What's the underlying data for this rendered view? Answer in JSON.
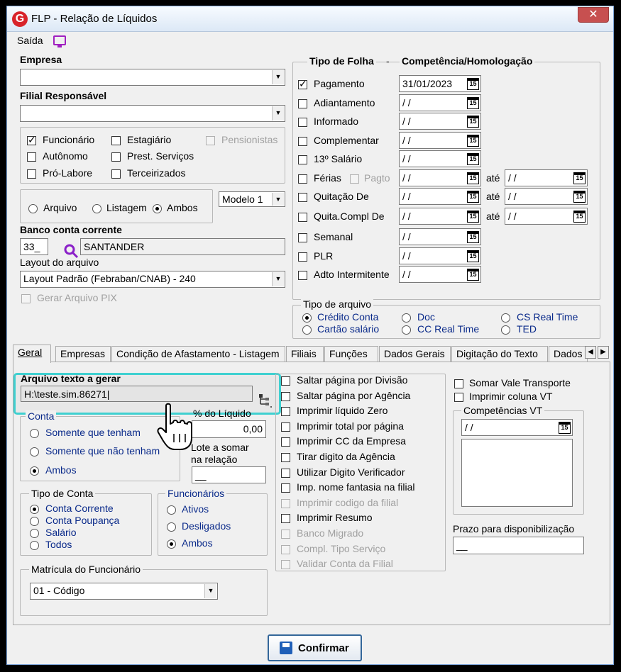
{
  "window": {
    "title": "FLP - Relação de Líquidos",
    "logo": "G",
    "close": "✕"
  },
  "menu": {
    "saida": "Saída"
  },
  "empresa": {
    "label": "Empresa",
    "value": ""
  },
  "filial": {
    "label": "Filial Responsável",
    "value": ""
  },
  "categorias": [
    {
      "label": "Funcionário",
      "checked": true,
      "enabled": true
    },
    {
      "label": "Estagiário",
      "checked": false,
      "enabled": true
    },
    {
      "label": "Pensionistas",
      "checked": false,
      "enabled": false
    },
    {
      "label": "Autônomo",
      "checked": false,
      "enabled": true
    },
    {
      "label": "Prest. Serviços",
      "checked": false,
      "enabled": true
    },
    {
      "label": "Pró-Labore",
      "checked": false,
      "enabled": true
    },
    {
      "label": "Terceirizados",
      "checked": false,
      "enabled": true
    }
  ],
  "saida_tipo": {
    "options": [
      "Arquivo",
      "Listagem",
      "Ambos"
    ],
    "selected": "Ambos"
  },
  "modelo": {
    "value": "Modelo 1"
  },
  "banco": {
    "label": "Banco conta corrente",
    "code": "33_",
    "name": "SANTANDER"
  },
  "layout": {
    "label": "Layout do arquivo",
    "value": "Layout Padrão (Febraban/CNAB) - 240"
  },
  "pix": {
    "label": "Gerar Arquivo PIX"
  },
  "folha": {
    "title_tipo": "Tipo de Folha",
    "title_comp": "Competência/Homologação",
    "ate": "até",
    "pagto": "Pagto",
    "items": [
      {
        "label": "Pagamento",
        "checked": true,
        "date": "31/01/2023",
        "end": ""
      },
      {
        "label": "Adiantamento",
        "checked": false,
        "date": "/ /",
        "end": ""
      },
      {
        "label": "Informado",
        "checked": false,
        "date": "/ /",
        "end": ""
      },
      {
        "label": "Complementar",
        "checked": false,
        "date": "/ /",
        "end": ""
      },
      {
        "label": "13º Salário",
        "checked": false,
        "date": "/ /",
        "end": ""
      },
      {
        "label": "Férias",
        "checked": false,
        "date": "/ /",
        "end": "/ /"
      },
      {
        "label": "Quitação De",
        "checked": false,
        "date": "/ /",
        "end": "/ /"
      },
      {
        "label": "Quita.Compl De",
        "checked": false,
        "date": "/ /",
        "end": "/ /"
      },
      {
        "label": "Semanal",
        "checked": false,
        "date": "/ /",
        "end": ""
      },
      {
        "label": "PLR",
        "checked": false,
        "date": "/ /",
        "end": ""
      },
      {
        "label": "Adto Intermitente",
        "checked": false,
        "date": "/ /",
        "end": ""
      }
    ]
  },
  "tipo_arquivo": {
    "title": "Tipo de arquivo",
    "options": [
      "Crédito Conta",
      "Doc",
      "CS Real Time",
      "Cartão salário",
      "CC Real Time",
      "TED"
    ],
    "selected": "Crédito Conta"
  },
  "tabs": [
    "Geral",
    "Empresas",
    "Condição de Afastamento - Listagem",
    "Filiais",
    "Funções",
    "Dados Gerais",
    "Digitação do Texto",
    "Dados"
  ],
  "geral": {
    "arquivo_label": "Arquivo texto a gerar",
    "arquivo_value": "H:\\teste.sim.86271|",
    "conta": {
      "title": "Conta",
      "options": [
        "Somente que tenham",
        "Somente que não tenham",
        "Ambos"
      ],
      "selected": "Ambos"
    },
    "perc_label": "% do Líquido",
    "perc_value": "0,00",
    "lote_label_1": "Lote a somar",
    "lote_label_2": "na relação",
    "lote_value": "__",
    "tipo_conta": {
      "title": "Tipo de Conta",
      "options": [
        "Conta Corrente",
        "Conta Poupança",
        "Salário",
        "Todos"
      ],
      "selected": "Conta Corrente"
    },
    "funcionarios": {
      "title": "Funcionários",
      "options": [
        "Ativos",
        "Desligados",
        "Ambos"
      ],
      "selected": "Ambos"
    },
    "matricula": {
      "title": "Matrícula do Funcionário",
      "value": "01 - Código"
    },
    "opcoes": [
      {
        "label": "Saltar página por Divisão",
        "enabled": true
      },
      {
        "label": "Saltar página por Agência",
        "enabled": true
      },
      {
        "label": "Imprimir líquido Zero",
        "enabled": true
      },
      {
        "label": "Imprimir total por página",
        "enabled": true
      },
      {
        "label": "Imprimir CC da Empresa",
        "enabled": true
      },
      {
        "label": "Tirar digito da Agência",
        "enabled": true
      },
      {
        "label": "Utilizar Digito Verificador",
        "enabled": true
      },
      {
        "label": "Imp. nome fantasia na filial",
        "enabled": true
      },
      {
        "label": "Imprimir codigo da filial",
        "enabled": false
      },
      {
        "label": "Imprimir Resumo",
        "enabled": true
      },
      {
        "label": "Banco Migrado",
        "enabled": false
      },
      {
        "label": "Compl. Tipo Serviço",
        "enabled": false
      },
      {
        "label": "Validar Conta da Filial",
        "enabled": false
      }
    ],
    "vale_transporte": "Somar Vale Transporte",
    "coluna_vt": "Imprimir coluna VT",
    "comp_vt": {
      "title": "Competências VT",
      "value": "/ /"
    },
    "prazo": {
      "label": "Prazo para disponibilização",
      "value": "__"
    }
  },
  "confirmar": "Confirmar"
}
